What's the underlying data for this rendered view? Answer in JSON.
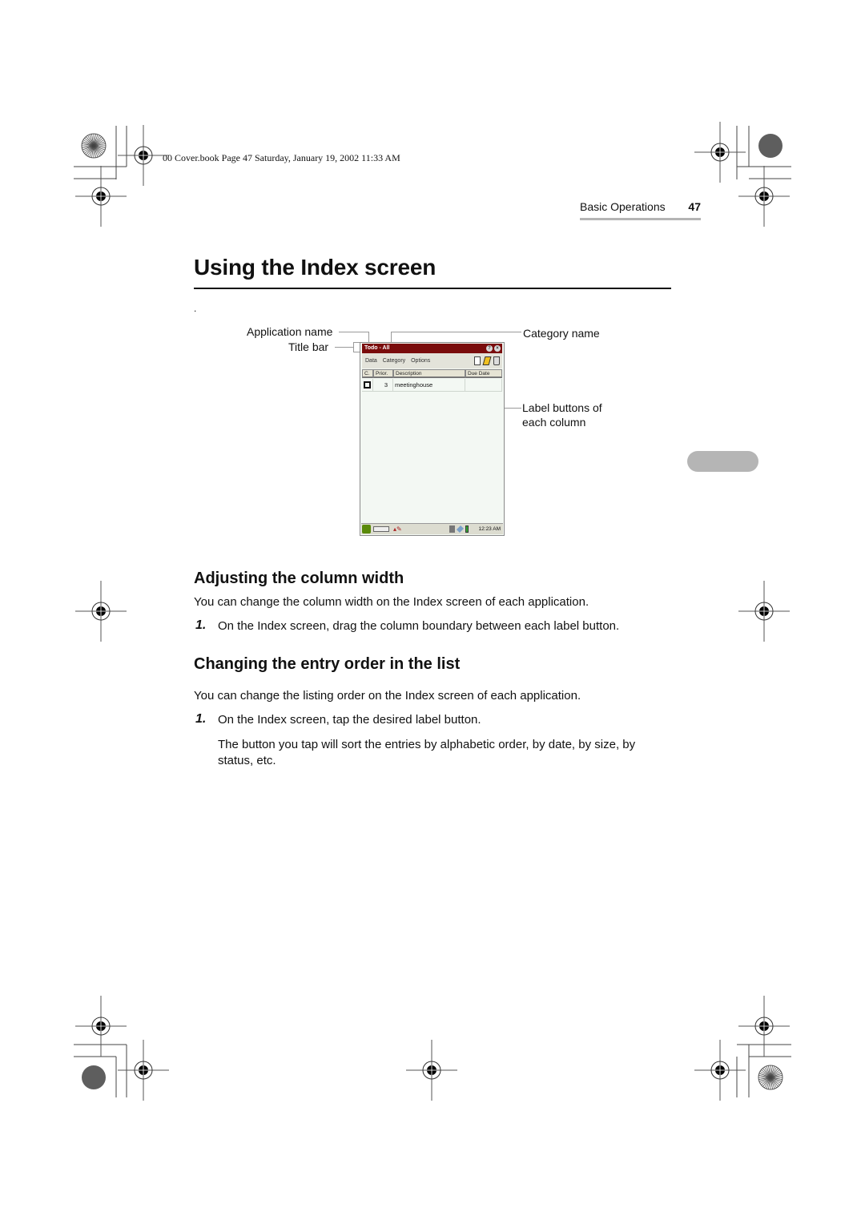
{
  "print_stamp": "00 Cover.book  Page 47  Saturday, January 19, 2002  11:33 AM",
  "running_header": {
    "section": "Basic Operations",
    "page_number": "47"
  },
  "page_title": "Using the Index screen",
  "stray_dot": ".",
  "figure": {
    "callouts": {
      "application_name": "Application name",
      "title_bar": "Title bar",
      "category_name": "Category name",
      "label_buttons_line1": "Label buttons of",
      "label_buttons_line2": "each column"
    },
    "device": {
      "title": "Todo - All",
      "title_buttons": [
        "?",
        "×"
      ],
      "menu": [
        "Data",
        "Category",
        "Options"
      ],
      "toolbar_icons": [
        "new-document-icon",
        "edit-pen-icon",
        "trash-icon"
      ],
      "columns": [
        "C.",
        "Prior.",
        "Description",
        "Due Date"
      ],
      "rows": [
        {
          "checked": false,
          "priority": "3",
          "description": "meetinghouse",
          "due_date": ""
        }
      ],
      "status_bar": {
        "icons": [
          "go-menu-icon",
          "keyboard-icon",
          "pen-input-icon",
          "speaker-icon",
          "network-icon",
          "battery-icon"
        ],
        "clock": "12:23 AM"
      }
    }
  },
  "sections": [
    {
      "heading": "Adjusting the column width",
      "intro": "You can change the column width on the Index screen of each application.",
      "steps": [
        {
          "number": "1.",
          "text": "On the Index screen, drag the column boundary between each label button."
        }
      ]
    },
    {
      "heading": "Changing the entry order in the list",
      "intro": "You can change the listing order on the Index screen of each application.",
      "steps": [
        {
          "number": "1.",
          "text": "On the Index screen, tap the desired label button.",
          "note_line1": "The button you tap will sort the entries by alphabetic order, by date, by size, by",
          "note_line2": "status, etc."
        }
      ]
    }
  ],
  "colors": {
    "title_bar": "#7a0c0c",
    "screen_bg": "#f3f8f3",
    "thumb_tab": "#b5b5b5"
  }
}
